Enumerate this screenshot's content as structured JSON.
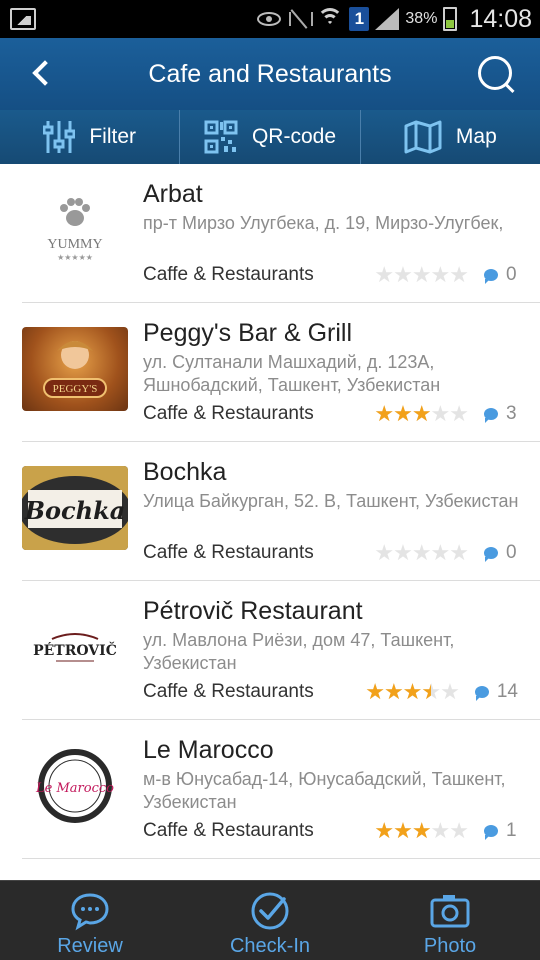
{
  "statusbar": {
    "battery_percent": "38%",
    "time": "14:08",
    "notification_count": "1"
  },
  "header": {
    "title": "Cafe and Restaurants"
  },
  "toolbar": {
    "filter_label": "Filter",
    "qr_label": "QR-code",
    "map_label": "Map"
  },
  "places": [
    {
      "name": "Arbat",
      "address": "пр-т Мирзо Улугбека, д. 19, Мирзо-Улугбек,",
      "category": "Caffe & Restaurants",
      "rating": 0,
      "comments": "0",
      "logo": "yummy-logo",
      "logo_text": "YUMMY"
    },
    {
      "name": "Peggy's Bar & Grill",
      "address": "ул. Султанали Машхадий, д. 123А, Яшнобадский, Ташкент, Узбекистан",
      "category": "Caffe & Restaurants",
      "rating": 3,
      "comments": "3",
      "logo": "peggys-logo",
      "logo_text": "PEGGY'S"
    },
    {
      "name": "Bochka",
      "address": "Улица Байкурган, 52. В, Ташкент, Узбекистан",
      "category": "Caffe & Restaurants",
      "rating": 0,
      "comments": "0",
      "logo": "bochka-logo",
      "logo_text": "Bochka"
    },
    {
      "name": "Pétrovič Restaurant",
      "address": "ул. Мавлона Риёзи, дом 47, Ташкент, Узбекистан",
      "category": "Caffe & Restaurants",
      "rating": 3.5,
      "comments": "14",
      "logo": "petrovic-logo",
      "logo_text": "PÉTROVIČ"
    },
    {
      "name": "Le Marocco",
      "address": "м-в Юнусабад-14, Юнусабадский, Ташкент, Узбекистан",
      "category": "Caffe & Restaurants",
      "rating": 3,
      "comments": "1",
      "logo": "le-marocco-logo",
      "logo_text": "Le Marocco"
    }
  ],
  "bottomnav": {
    "review_label": "Review",
    "checkin_label": "Check-In",
    "photo_label": "Photo"
  },
  "colors": {
    "header": "#1b5f9a",
    "star": "#f2a11a",
    "accent": "#5aa6e6"
  }
}
